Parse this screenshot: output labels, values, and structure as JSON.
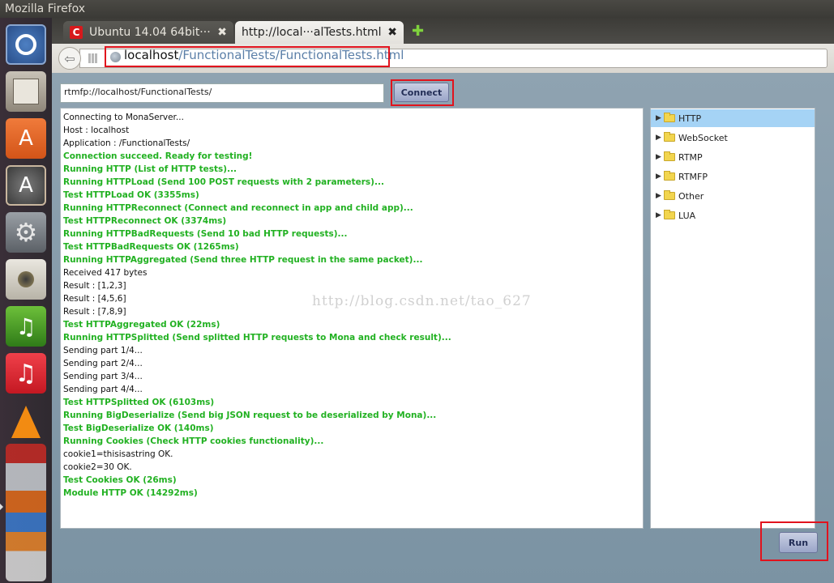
{
  "window": {
    "title": "Mozilla Firefox"
  },
  "launcher": {
    "items": [
      {
        "name": "ubuntu-dash-icon",
        "glyph": ""
      },
      {
        "name": "files-icon",
        "glyph": ""
      },
      {
        "name": "software-center-icon",
        "glyph": "A"
      },
      {
        "name": "update-manager-icon",
        "glyph": "A"
      },
      {
        "name": "system-settings-icon",
        "glyph": "⚙"
      },
      {
        "name": "speaker-icon",
        "glyph": ""
      },
      {
        "name": "music-app-icon",
        "glyph": "♫"
      },
      {
        "name": "itunes-icon",
        "glyph": "♫"
      },
      {
        "name": "vlc-icon",
        "glyph": ""
      },
      {
        "name": "app-stack-icon",
        "glyph": ""
      }
    ]
  },
  "tabs": [
    {
      "label": "Ubuntu 14.04 64bit···",
      "close": "✖",
      "active": false
    },
    {
      "label": "http://local···alTests.html",
      "close": "✖",
      "active": true
    }
  ],
  "new_tab": "✚",
  "nav": {
    "back": "⇦",
    "url_host": "localhost",
    "url_path": "/FunctionalTests/FunctionalTests.html"
  },
  "page": {
    "server_url": "rtmfp://localhost/FunctionalTests/",
    "connect_label": "Connect",
    "run_label": "Run",
    "watermark": "http://blog.csdn.net/tao_627",
    "log": [
      {
        "text": "Connecting to MonaServer...",
        "ok": false
      },
      {
        "text": "Host : localhost",
        "ok": false
      },
      {
        "text": "Application : /FunctionalTests/",
        "ok": false
      },
      {
        "text": "Connection succeed. Ready for testing!",
        "ok": true
      },
      {
        "text": "Running HTTP (List of HTTP tests)...",
        "ok": true
      },
      {
        "text": "Running HTTPLoad (Send 100 POST requests with 2 parameters)...",
        "ok": true
      },
      {
        "text": "Test HTTPLoad OK (3355ms)",
        "ok": true
      },
      {
        "text": "Running HTTPReconnect (Connect and reconnect in app and child app)...",
        "ok": true
      },
      {
        "text": "Test HTTPReconnect OK (3374ms)",
        "ok": true
      },
      {
        "text": "Running HTTPBadRequests (Send 10 bad HTTP requests)...",
        "ok": true
      },
      {
        "text": "Test HTTPBadRequests OK (1265ms)",
        "ok": true
      },
      {
        "text": "Running HTTPAggregated (Send three HTTP request in the same packet)...",
        "ok": true
      },
      {
        "text": "Received 417 bytes",
        "ok": false
      },
      {
        "text": "Result : [1,2,3]",
        "ok": false
      },
      {
        "text": "Result : [4,5,6]",
        "ok": false
      },
      {
        "text": "Result : [7,8,9]",
        "ok": false
      },
      {
        "text": "Test HTTPAggregated OK (22ms)",
        "ok": true
      },
      {
        "text": "Running HTTPSplitted (Send splitted HTTP requests to Mona and check result)...",
        "ok": true
      },
      {
        "text": "Sending part 1/4...",
        "ok": false
      },
      {
        "text": "Sending part 2/4...",
        "ok": false
      },
      {
        "text": "Sending part 3/4...",
        "ok": false
      },
      {
        "text": "Sending part 4/4...",
        "ok": false
      },
      {
        "text": "Test HTTPSplitted OK (6103ms)",
        "ok": true
      },
      {
        "text": "Running BigDeserialize (Send big JSON request to be deserialized by Mona)...",
        "ok": true
      },
      {
        "text": "Test BigDeserialize OK (140ms)",
        "ok": true
      },
      {
        "text": "Running Cookies (Check HTTP cookies functionality)...",
        "ok": true
      },
      {
        "text": "cookie1=thisisastring OK.",
        "ok": false
      },
      {
        "text": "cookie2=30 OK.",
        "ok": false
      },
      {
        "text": "Test Cookies OK (26ms)",
        "ok": true
      },
      {
        "text": "Module HTTP OK (14292ms)",
        "ok": true
      }
    ],
    "tree": [
      {
        "label": "HTTP",
        "selected": true
      },
      {
        "label": "WebSocket",
        "selected": false
      },
      {
        "label": "RTMP",
        "selected": false
      },
      {
        "label": "RTMFP",
        "selected": false
      },
      {
        "label": "Other",
        "selected": false
      },
      {
        "label": "LUA",
        "selected": false
      }
    ],
    "tree_arrow": "▶"
  },
  "colors": {
    "ok_green": "#22b122",
    "highlight_red": "#e1131d",
    "selected_blue": "#a5d3f5"
  }
}
